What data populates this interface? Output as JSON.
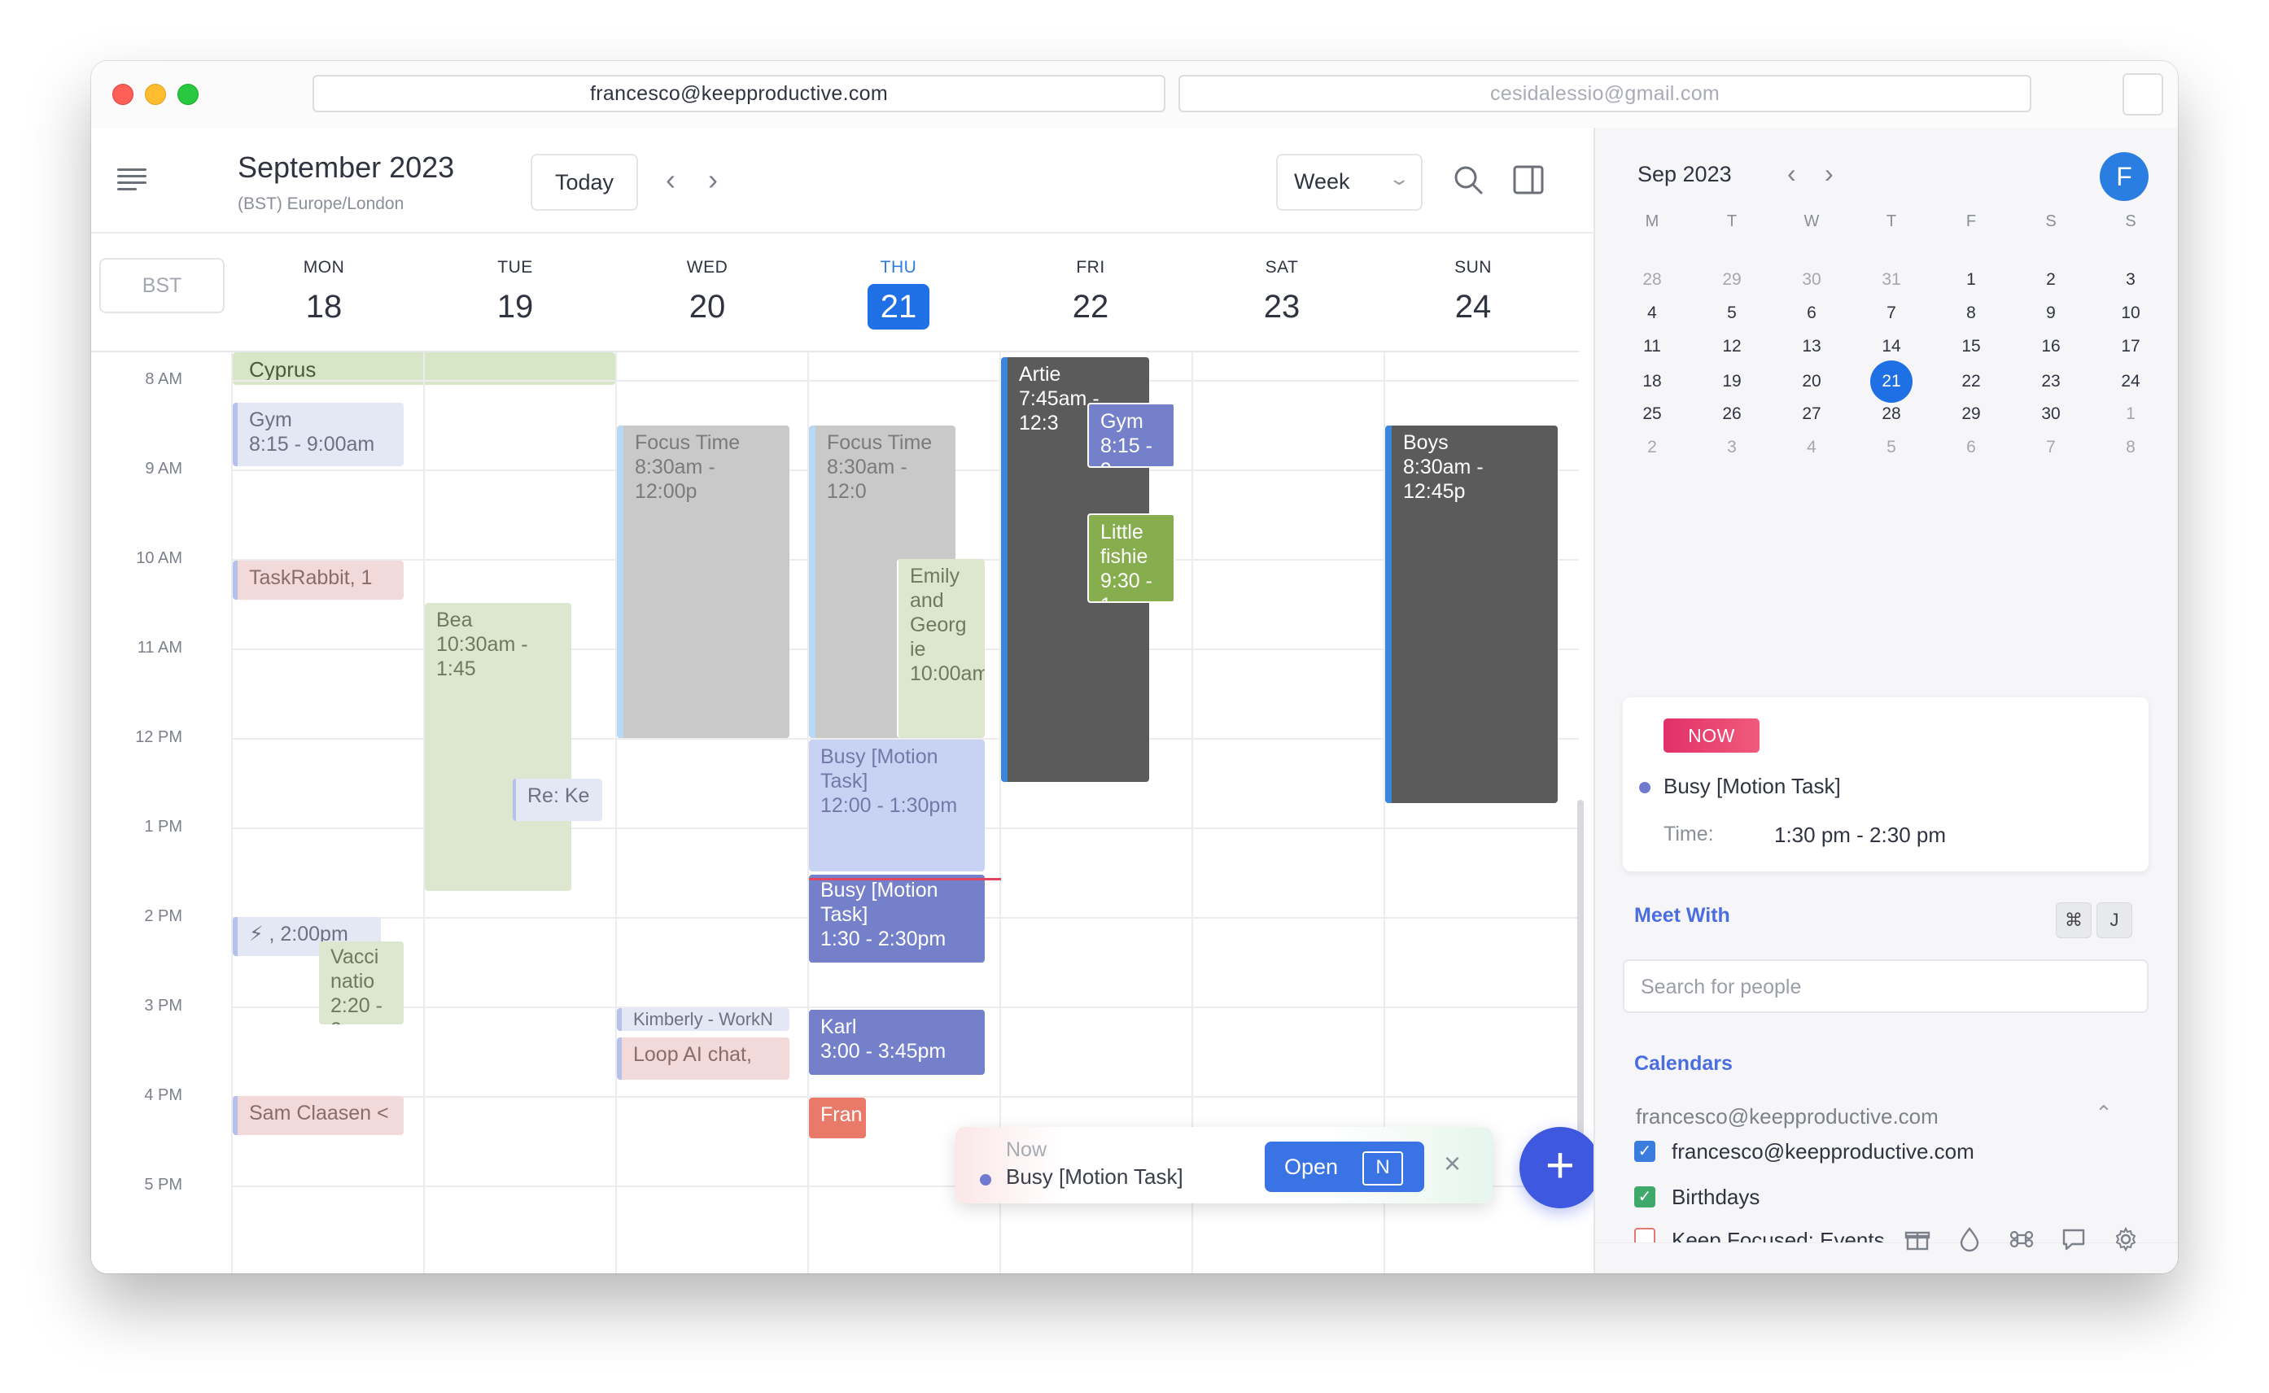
{
  "window": {
    "accounts": [
      "francesco@keepproductive.com",
      "cesidalessio@gmail.com"
    ]
  },
  "header": {
    "month_title": "September 2023",
    "timezone": "(BST) Europe/London",
    "today_label": "Today",
    "view": "Week",
    "bst_label": "BST"
  },
  "days": [
    {
      "name": "MON",
      "num": "18"
    },
    {
      "name": "TUE",
      "num": "19"
    },
    {
      "name": "WED",
      "num": "20"
    },
    {
      "name": "THU",
      "num": "21"
    },
    {
      "name": "FRI",
      "num": "22"
    },
    {
      "name": "SAT",
      "num": "23"
    },
    {
      "name": "SUN",
      "num": "24"
    }
  ],
  "all_day": {
    "title": "Cyprus"
  },
  "hours": [
    "8 AM",
    "9 AM",
    "10 AM",
    "11 AM",
    "12 PM",
    "1 PM",
    "2 PM",
    "3 PM",
    "4 PM",
    "5 PM"
  ],
  "events": {
    "gym_mon": {
      "title": "Gym",
      "time": "8:15 - 9:00am"
    },
    "taskrabbit": {
      "title": "TaskRabbit, 1"
    },
    "lightning": {
      "title": "⚡ , 2:00pm"
    },
    "vacci": {
      "title": "Vacci natio",
      "time": "2:20 - 3"
    },
    "sam": {
      "title": "Sam Claasen <"
    },
    "bea": {
      "title": "Bea",
      "time": "10:30am - 1:45"
    },
    "reke": {
      "title": "Re: Ke"
    },
    "focus_wed": {
      "title": "Focus Time",
      "time": "8:30am - 12:00p"
    },
    "kimberly": {
      "title": "Kimberly - WorkN"
    },
    "loop": {
      "title": "Loop AI chat,"
    },
    "focus_thu": {
      "title": "Focus Time",
      "time": "8:30am - 12:0"
    },
    "emily": {
      "title": "Emily and Georg ie",
      "time": "10:00am"
    },
    "busy1": {
      "title": "Busy [Motion Task]",
      "time": "12:00 - 1:30pm"
    },
    "busy2": {
      "title": "Busy [Motion Task]",
      "time": "1:30 - 2:30pm"
    },
    "karl": {
      "title": "Karl",
      "time": "3:00 - 3:45pm"
    },
    "fran": {
      "title": "Fran"
    },
    "artie": {
      "title": "Artie",
      "time": "7:45am - 12:3"
    },
    "gym_fri": {
      "title": "Gym",
      "time": "8:15 - 9"
    },
    "little": {
      "title": "Little fishie",
      "time": "9:30 - 1"
    },
    "boys": {
      "title": "Boys",
      "time": "8:30am - 12:45p"
    }
  },
  "toast": {
    "now_label": "Now",
    "title": "Busy [Motion Task]",
    "open_label": "Open",
    "shortcut": "N"
  },
  "mini_cal": {
    "title": "Sep 2023",
    "weekdays": [
      "M",
      "T",
      "W",
      "T",
      "F",
      "S",
      "S"
    ],
    "weeks": [
      [
        "28",
        "29",
        "30",
        "31",
        "1",
        "2",
        "3"
      ],
      [
        "4",
        "5",
        "6",
        "7",
        "8",
        "9",
        "10"
      ],
      [
        "11",
        "12",
        "13",
        "14",
        "15",
        "16",
        "17"
      ],
      [
        "18",
        "19",
        "20",
        "21",
        "22",
        "23",
        "24"
      ],
      [
        "25",
        "26",
        "27",
        "28",
        "29",
        "30",
        "1"
      ],
      [
        "2",
        "3",
        "4",
        "5",
        "6",
        "7",
        "8"
      ]
    ],
    "avatar": "F"
  },
  "now_card": {
    "badge": "NOW",
    "title": "Busy [Motion Task]",
    "time_label": "Time:",
    "time": "1:30 pm - 2:30 pm"
  },
  "meet_with": {
    "title": "Meet With",
    "shortcut_keys": [
      "⌘",
      "J"
    ],
    "search_placeholder": "Search for people"
  },
  "calendars": {
    "title": "Calendars",
    "account": "francesco@keepproductive.com",
    "items": [
      {
        "label": "francesco@keepproductive.com",
        "checked": true,
        "color": "#3a7ddf"
      },
      {
        "label": "Birthdays",
        "checked": true,
        "color": "#3fa86b"
      },
      {
        "label": "Keep Focused: Events",
        "checked": false,
        "color": "#e07a72"
      }
    ]
  },
  "colors": {
    "accent": "#1f6fe5",
    "fab": "#3e59e0",
    "now_line": "#e2455f"
  }
}
